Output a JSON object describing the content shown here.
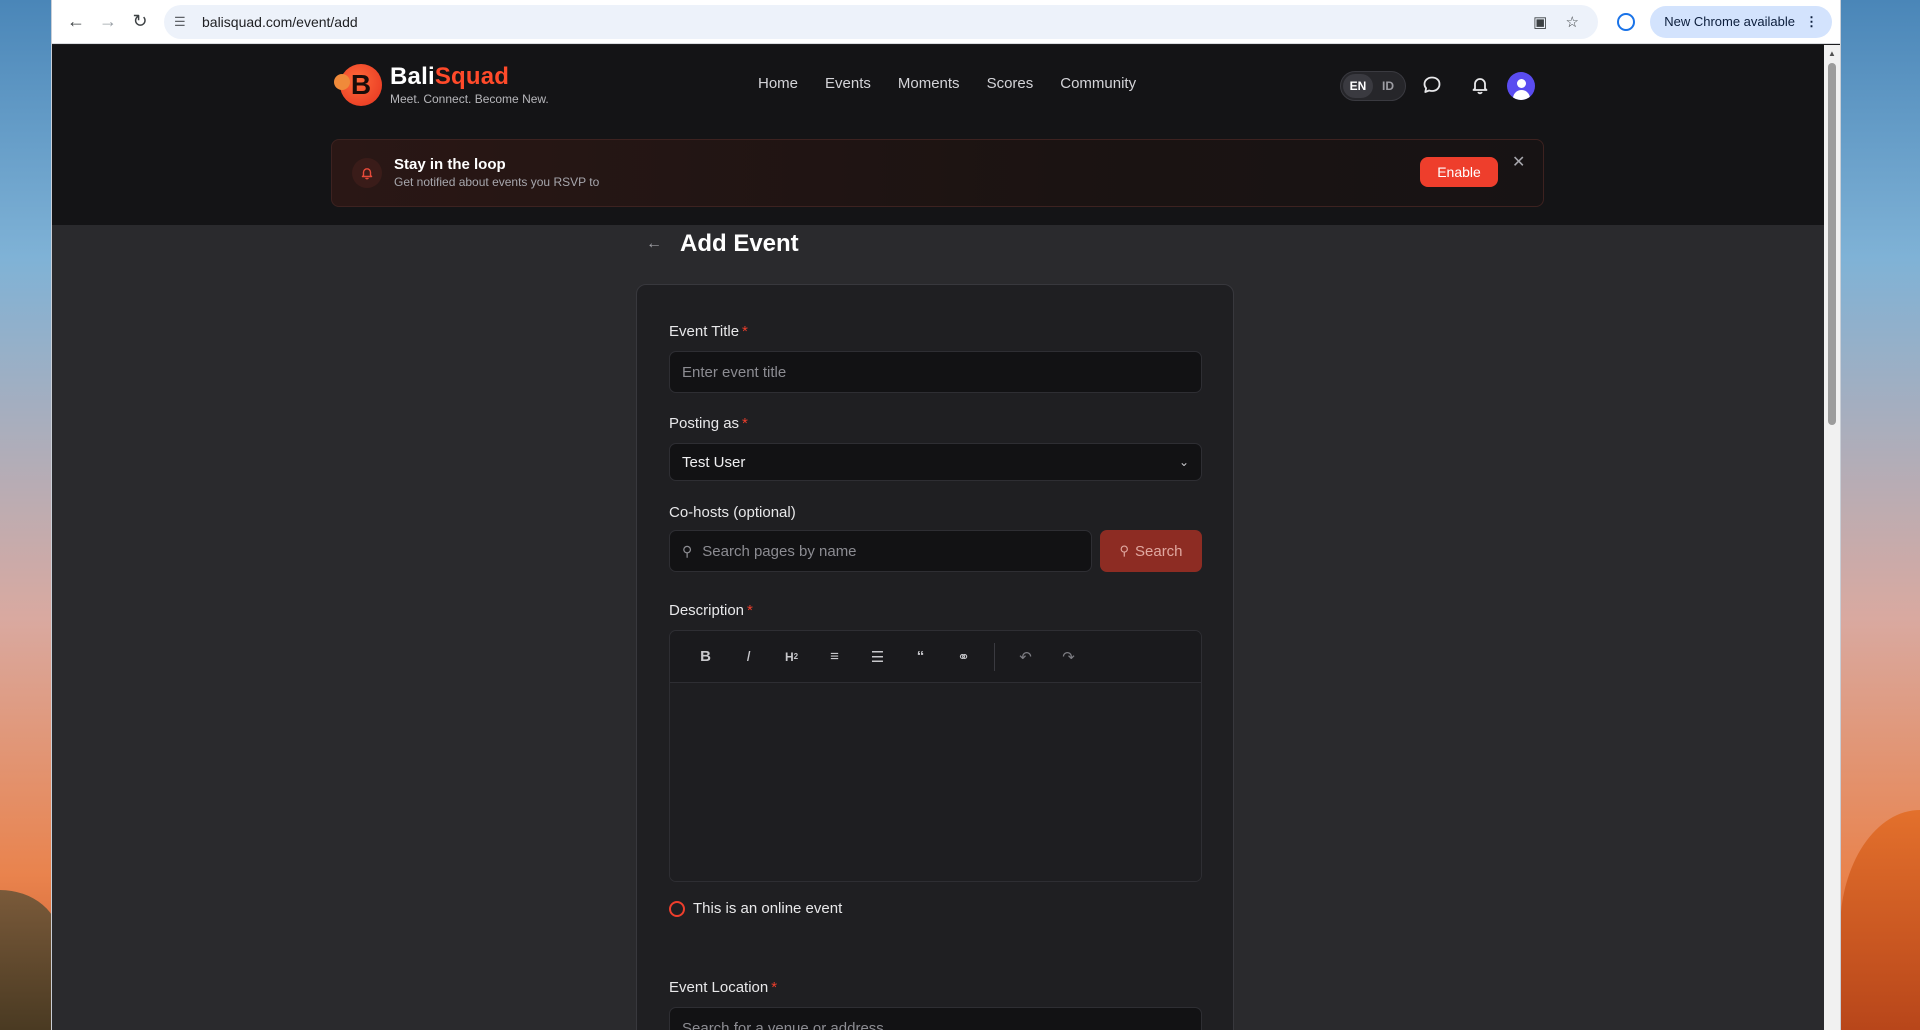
{
  "browser": {
    "url": "balisquad.com/event/add",
    "update_label": "New Chrome available"
  },
  "site": {
    "brand_first": "Bali",
    "brand_second": "Squad",
    "tagline": "Meet. Connect. Become New.",
    "nav": [
      "Home",
      "Events",
      "Moments",
      "Scores",
      "Community"
    ],
    "lang": [
      "EN",
      "ID"
    ],
    "active_lang": "EN"
  },
  "notify": {
    "title": "Stay in the loop",
    "subtitle": "Get notified about events you RSVP to",
    "enable_label": "Enable"
  },
  "page": {
    "title": "Add Event"
  },
  "form": {
    "event_title_label": "Event Title",
    "event_title_placeholder": "Enter event title",
    "posting_as_label": "Posting as",
    "posting_as_value": "Test User",
    "cohosts_label": "Co-hosts (optional)",
    "cohosts_placeholder": "Search pages by name",
    "search_label": "Search",
    "description_label": "Description",
    "online_label": "This is an online event",
    "location_label": "Event Location",
    "location_placeholder": "Search for a venue or address"
  },
  "required_mark": "*",
  "colors": {
    "accent": "#ee3e2c",
    "page_bg": "#2a2a2d",
    "header_bg": "#141416"
  }
}
